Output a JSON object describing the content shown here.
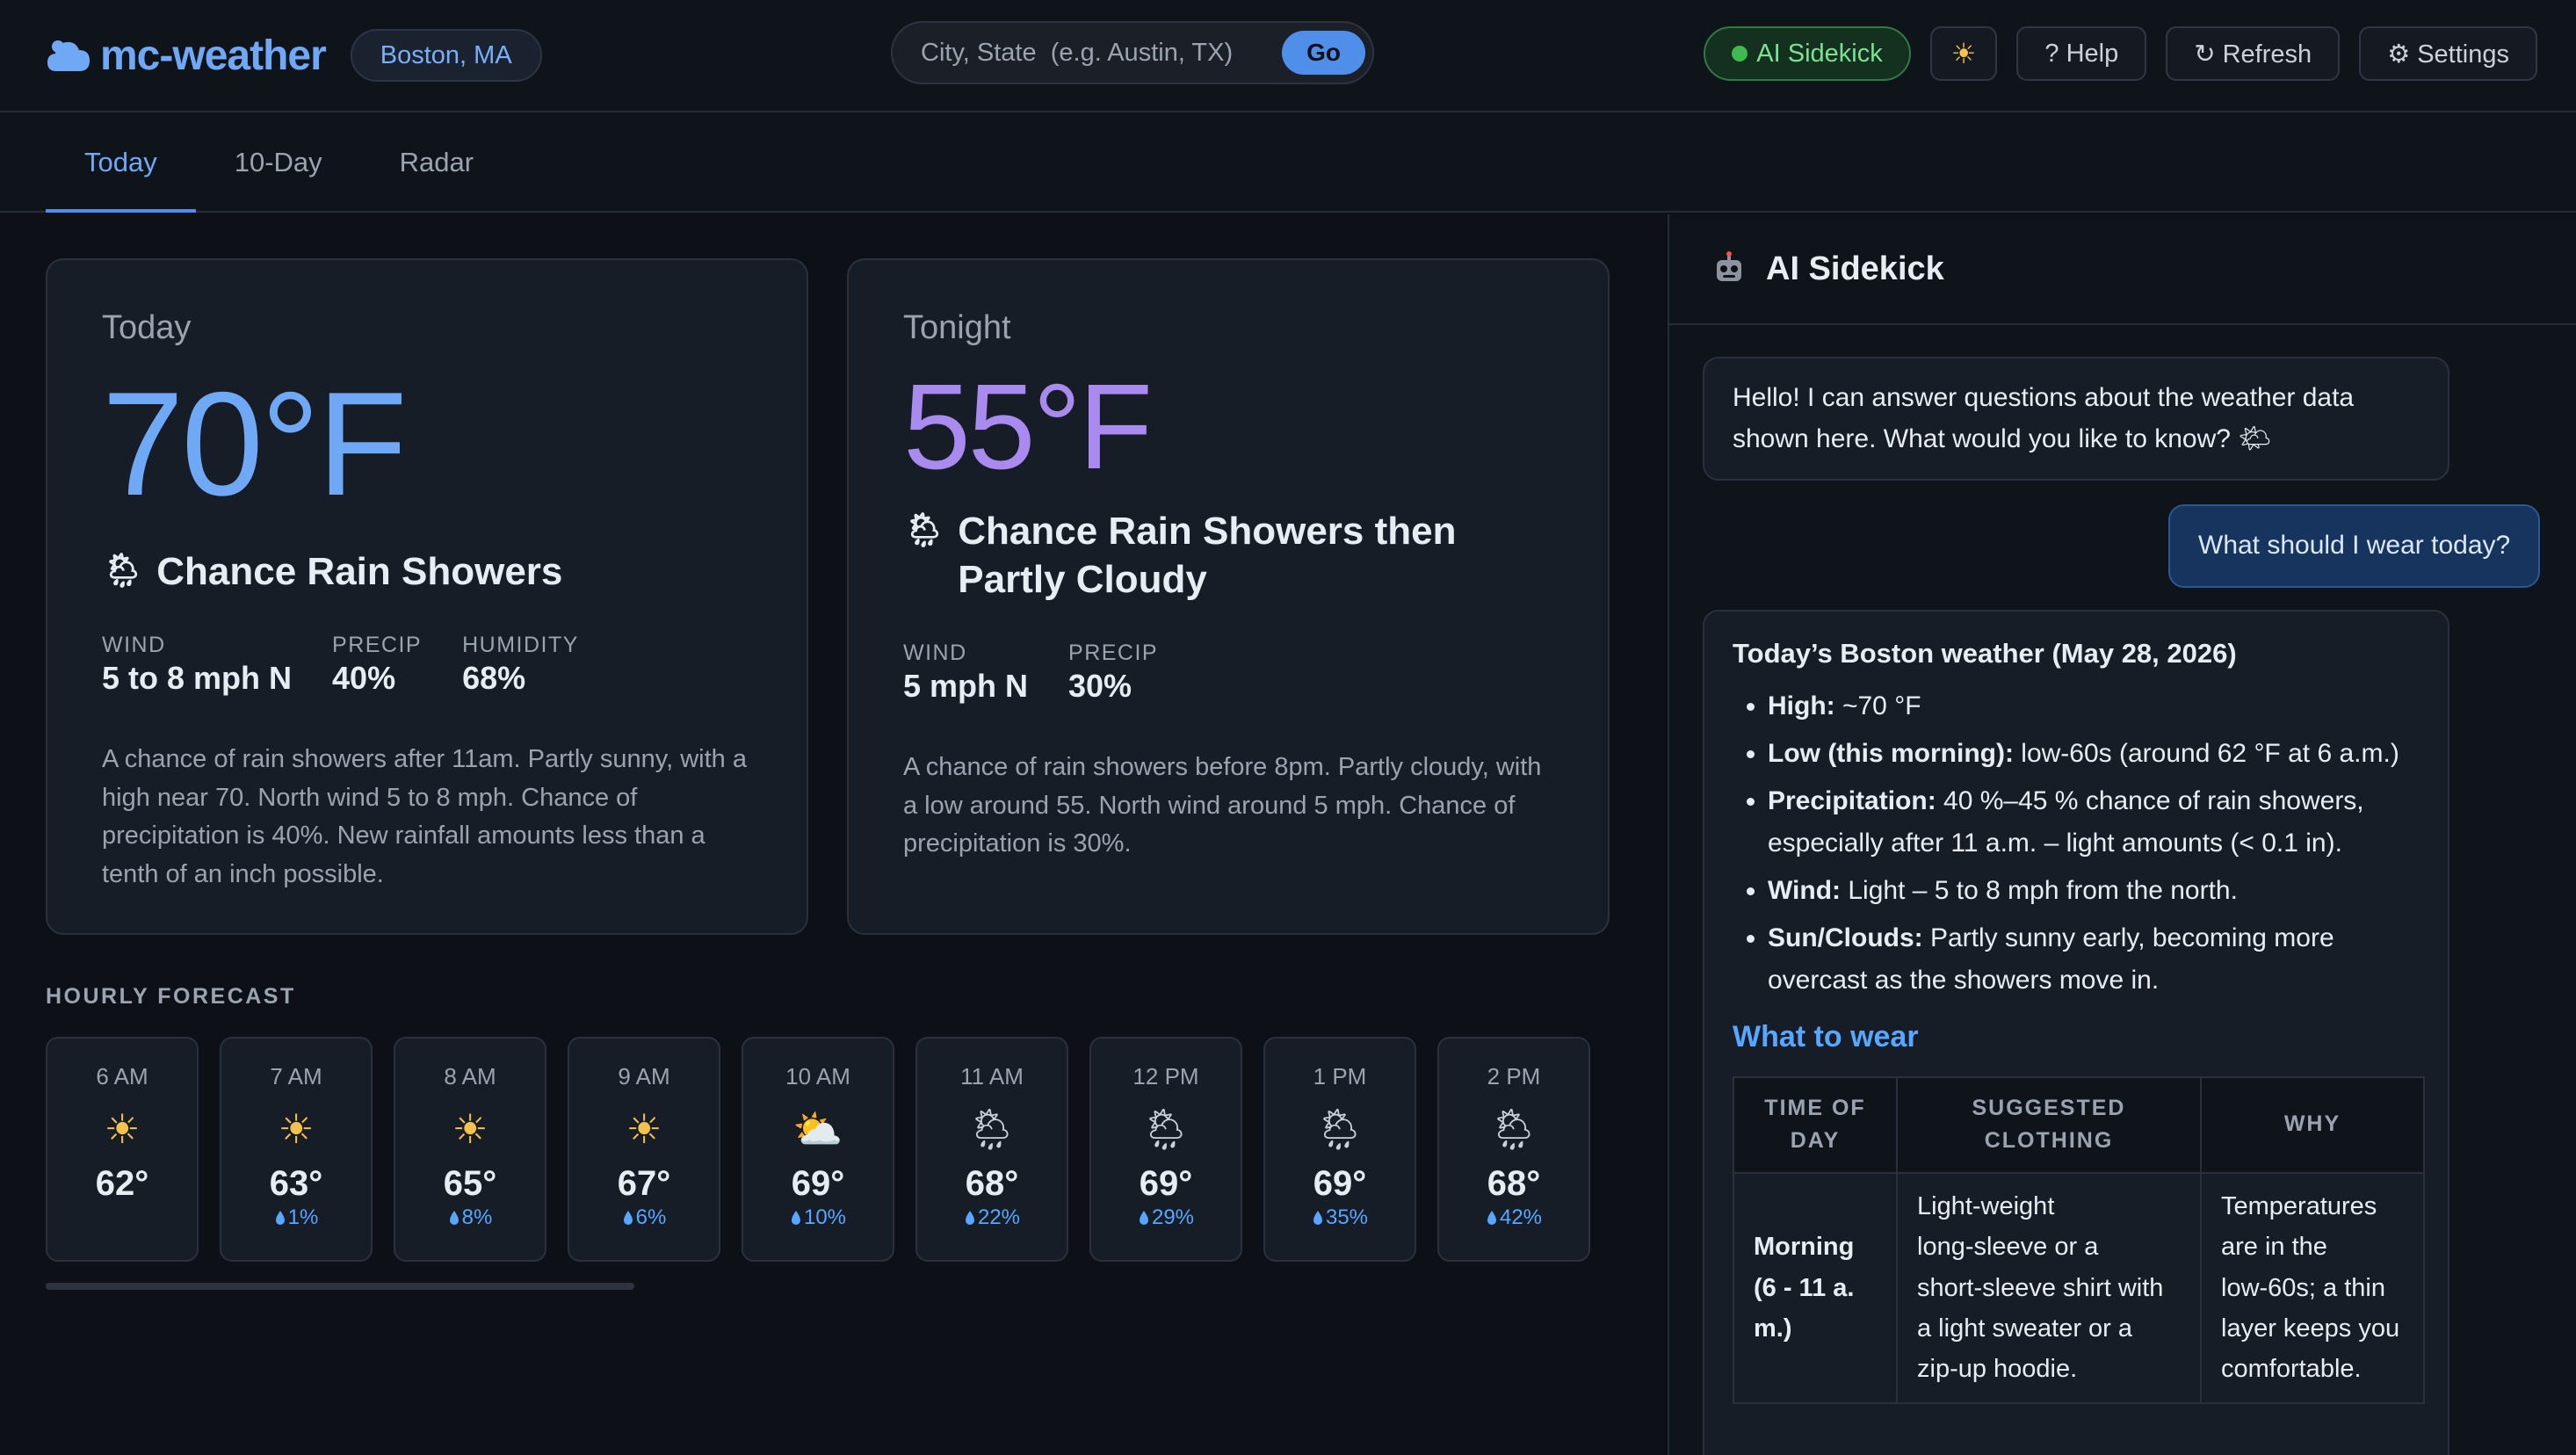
{
  "header": {
    "logo": "mc-weather",
    "location": "Boston, MA",
    "search_placeholder": "City, State  (e.g. Austin, TX)",
    "go_label": "Go",
    "ai_label": "AI Sidekick",
    "theme_icon": "sun-icon",
    "help_label": "? Help",
    "refresh_label": "↻ Refresh",
    "settings_label": "⚙ Settings"
  },
  "tabs": [
    {
      "label": "Today",
      "active": true
    },
    {
      "label": "10-Day",
      "active": false
    },
    {
      "label": "Radar",
      "active": false
    }
  ],
  "today": {
    "label": "Today",
    "temp": "70°F",
    "condition": "Chance Rain Showers",
    "wind_label": "WIND",
    "wind": "5 to 8 mph N",
    "precip_label": "PRECIP",
    "precip": "40%",
    "humidity_label": "HUMIDITY",
    "humidity": "68%",
    "description": "A chance of rain showers after 11am. Partly sunny, with a high near 70. North wind 5 to 8 mph. Chance of precipitation is 40%. New rainfall amounts less than a tenth of an inch possible."
  },
  "tonight": {
    "label": "Tonight",
    "temp": "55°F",
    "condition": "Chance Rain Showers then Partly Cloudy",
    "wind_label": "WIND",
    "wind": "5 mph N",
    "precip_label": "PRECIP",
    "precip": "30%",
    "description": "A chance of rain showers before 8pm. Partly cloudy, with a low around 55. North wind around 5 mph. Chance of precipitation is 30%."
  },
  "hourly": {
    "title": "HOURLY FORECAST",
    "items": [
      {
        "time": "6 AM",
        "icon": "sun-icon",
        "temp": "62°",
        "precip": ""
      },
      {
        "time": "7 AM",
        "icon": "sun-icon",
        "temp": "63°",
        "precip": "1%"
      },
      {
        "time": "8 AM",
        "icon": "sun-icon",
        "temp": "65°",
        "precip": "8%"
      },
      {
        "time": "9 AM",
        "icon": "sun-icon",
        "temp": "67°",
        "precip": "6%"
      },
      {
        "time": "10 AM",
        "icon": "partly-cloudy-icon",
        "temp": "69°",
        "precip": "10%"
      },
      {
        "time": "11 AM",
        "icon": "sun-rain-icon",
        "temp": "68°",
        "precip": "22%"
      },
      {
        "time": "12 PM",
        "icon": "sun-rain-icon",
        "temp": "69°",
        "precip": "29%"
      },
      {
        "time": "1 PM",
        "icon": "sun-rain-icon",
        "temp": "69°",
        "precip": "35%"
      },
      {
        "time": "2 PM",
        "icon": "sun-rain-icon",
        "temp": "68°",
        "precip": "42%"
      }
    ]
  },
  "sidekick": {
    "title": "AI Sidekick",
    "greeting": "Hello! I can answer questions about the weather data shown here. What would you like to know? 🌤",
    "user_question": "What should I wear today?",
    "answer_title": "Today’s Boston weather (May 28, 2026)",
    "bullets": [
      {
        "label": "High:",
        "text": " ~70 °F"
      },
      {
        "label": "Low (this morning):",
        "text": " low‑60s (around 62 °F at 6 a.m.)"
      },
      {
        "label": "Precipitation:",
        "text": " 40 %–45 % chance of rain showers, especially after 11 a.m. – light amounts (< 0.1 in)."
      },
      {
        "label": "Wind:",
        "text": " Light – 5 to 8 mph from the north."
      },
      {
        "label": "Sun/Clouds:",
        "text": " Partly sunny early, becoming more overcast as the showers move in."
      }
    ],
    "wear_title": "What to wear",
    "table": {
      "headers": [
        "TIME OF DAY",
        "SUGGESTED CLOTHING",
        "WHY"
      ],
      "rows": [
        [
          "Morning (6 - 11 a. m.)",
          "Light‑weight long‑sleeve or a short‑sleeve shirt with a light sweater or a zip‑up hoodie.",
          "Temperatures are in the low‑60s; a thin layer keeps you comfortable."
        ]
      ]
    }
  }
}
